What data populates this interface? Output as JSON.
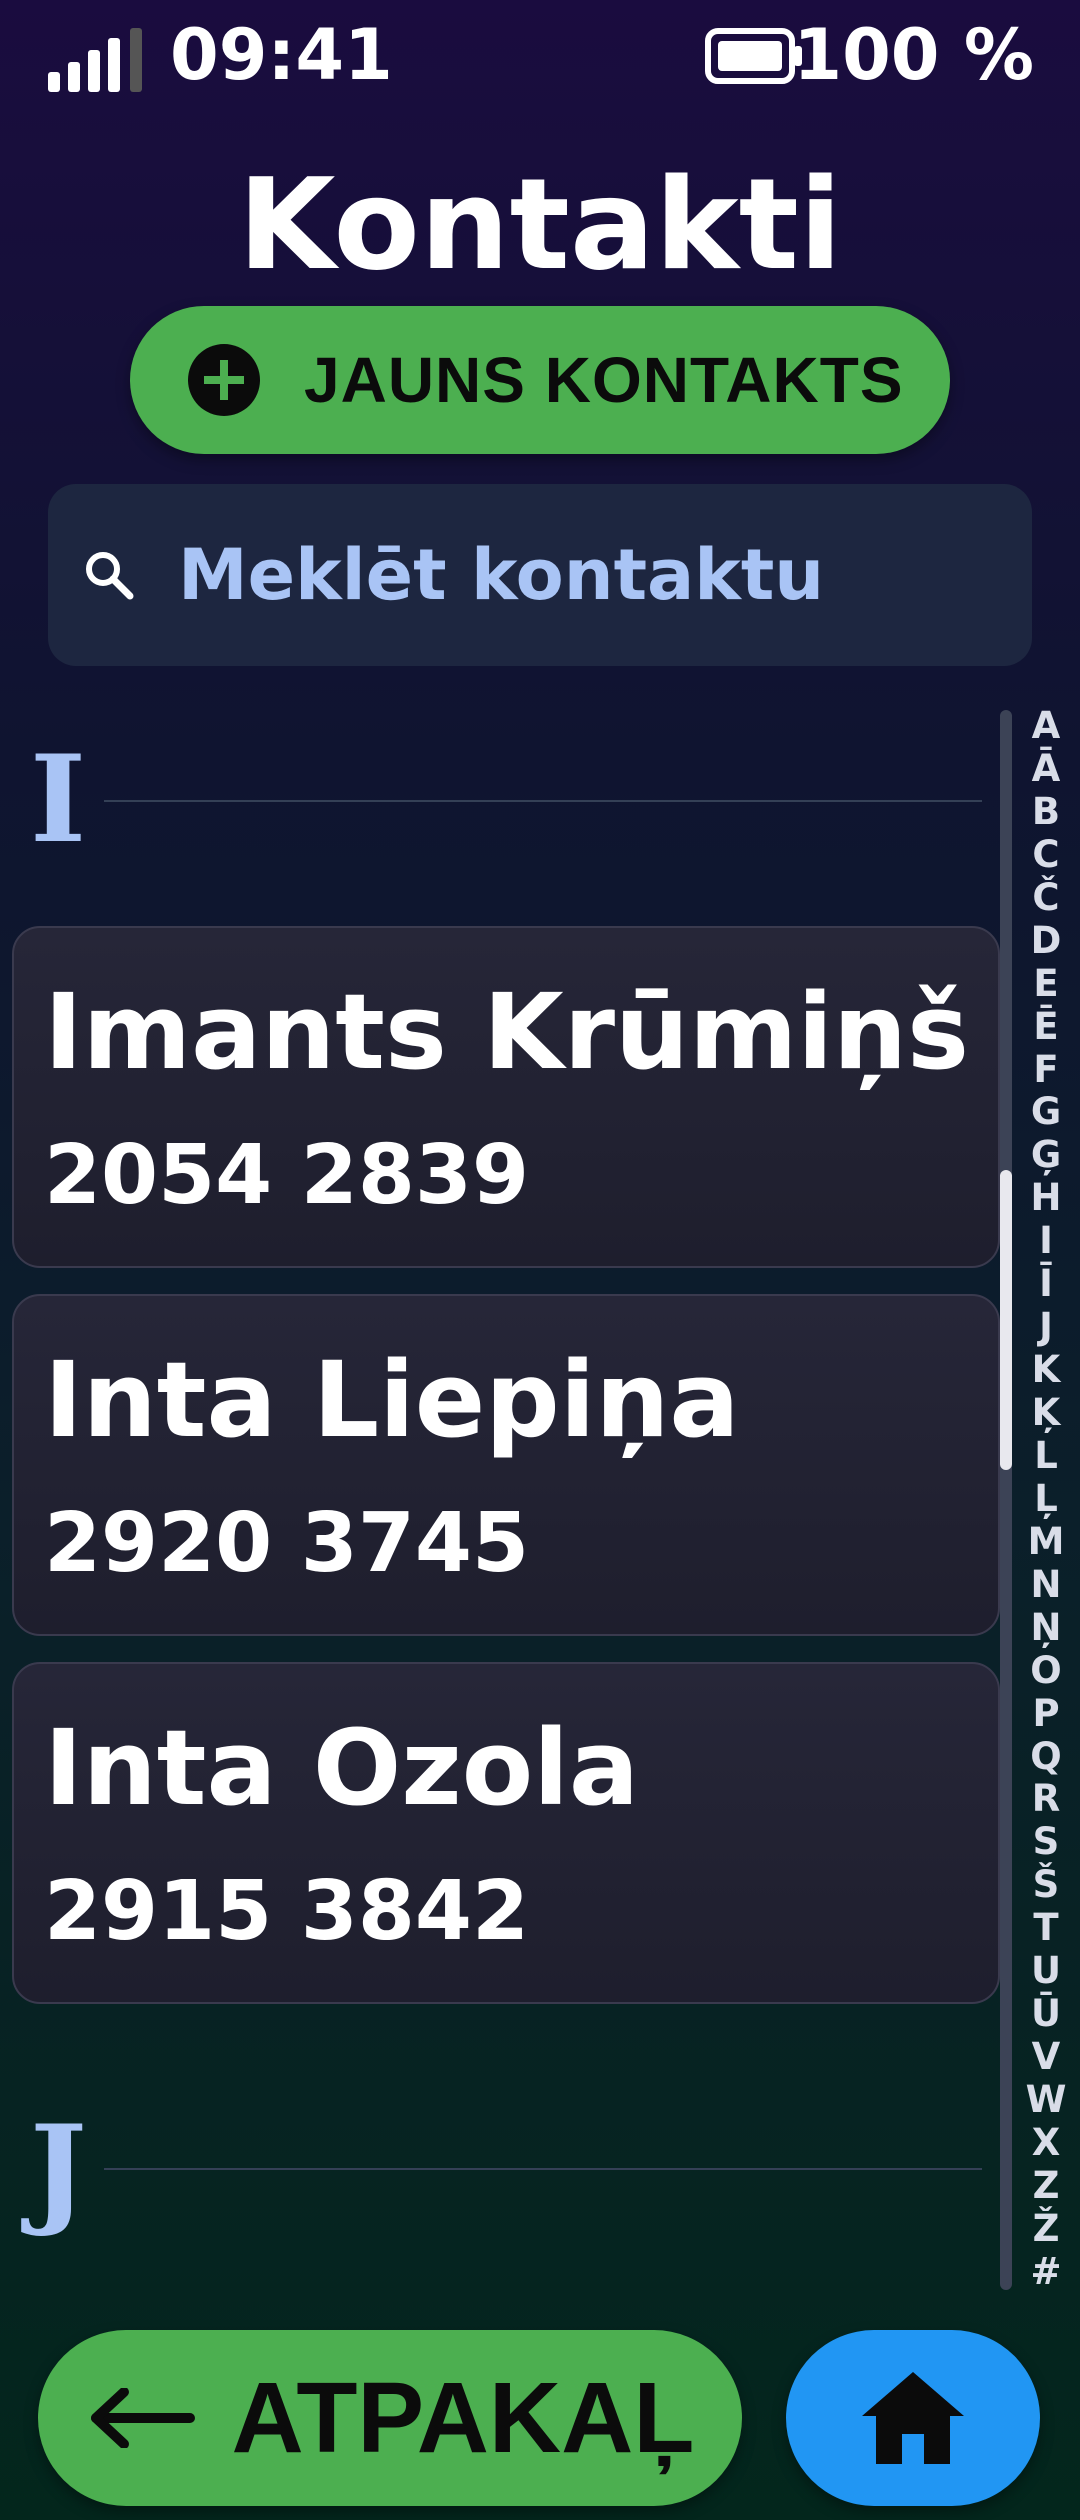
{
  "status": {
    "time": "09:41",
    "battery": "100 %"
  },
  "header": {
    "title": "Kontakti"
  },
  "actions": {
    "new_contact": "JAUNS KONTAKTS"
  },
  "search": {
    "placeholder": "Meklēt kontaktu"
  },
  "sections": [
    {
      "letter": "I",
      "contacts": [
        {
          "name": "Imants Krūmiņš",
          "phone": "2054 2839"
        },
        {
          "name": "Inta Liepiņa",
          "phone": "2920 3745"
        },
        {
          "name": "Inta Ozola",
          "phone": "2915 3842"
        }
      ]
    },
    {
      "letter": "J"
    }
  ],
  "alphabet": [
    "A",
    "Ā",
    "B",
    "C",
    "Č",
    "D",
    "E",
    "Ē",
    "F",
    "G",
    "Ģ",
    "H",
    "I",
    "Ī",
    "J",
    "K",
    "Ķ",
    "L",
    "Ļ",
    "M",
    "N",
    "Ņ",
    "O",
    "P",
    "Q",
    "R",
    "S",
    "Š",
    "T",
    "U",
    "Ū",
    "V",
    "W",
    "X",
    "Z",
    "Ž",
    "#"
  ],
  "nav": {
    "back": "ATPAKAĻ"
  },
  "icons": {
    "signal": "signal-icon",
    "battery": "battery-icon",
    "plus": "plus-circle-icon",
    "search": "search-icon",
    "back": "arrow-left-icon",
    "home": "home-icon"
  },
  "colors": {
    "accent_green": "#4caf50",
    "accent_blue": "#2196f3",
    "section_letter": "#a9c4f5"
  }
}
